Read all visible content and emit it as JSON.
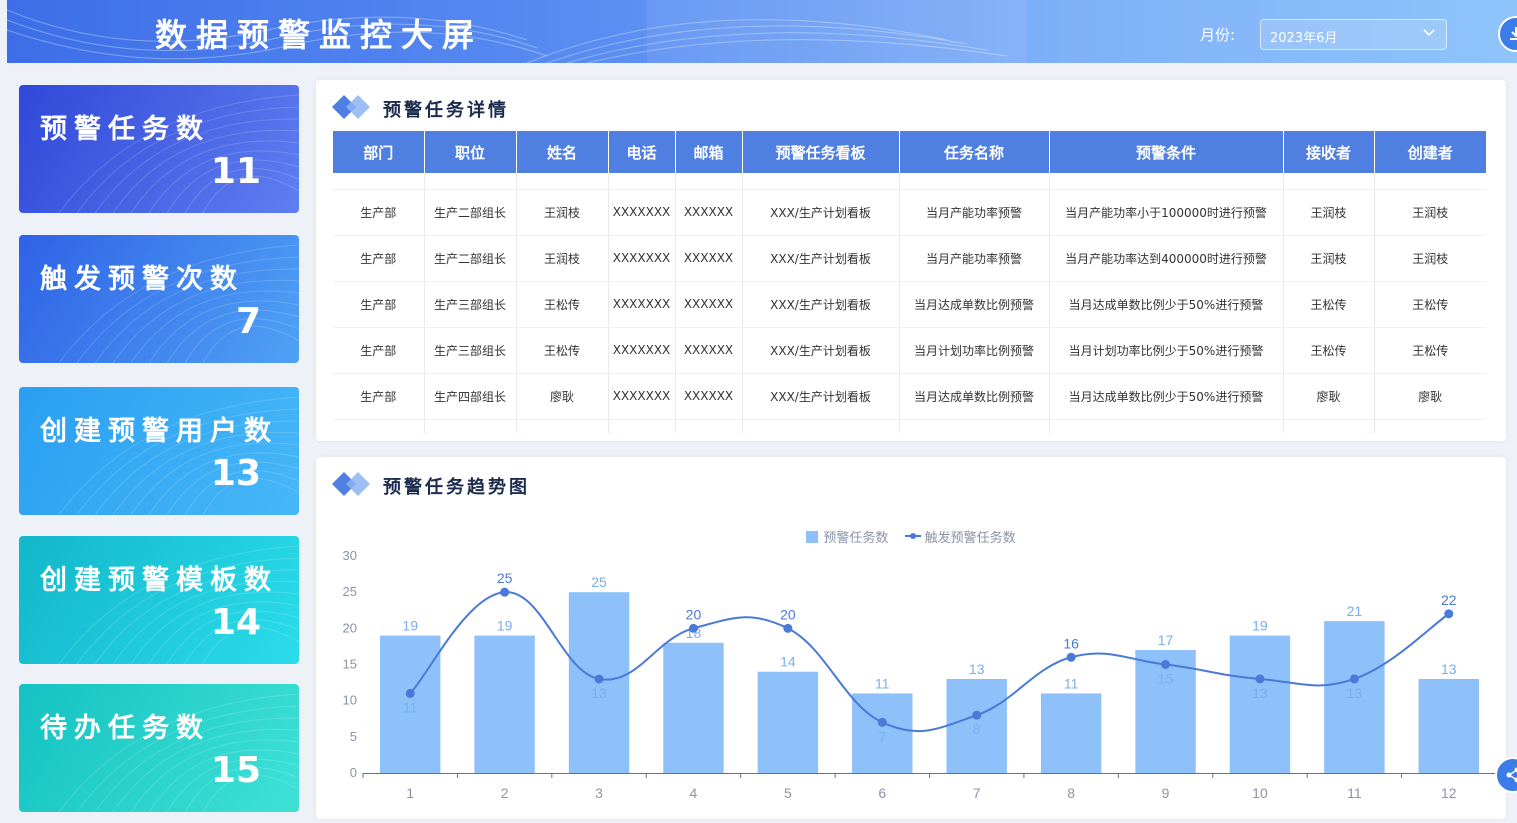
{
  "header": {
    "title": "数据预警监控大屏",
    "month_label": "月份:",
    "month_value": "2023年6月"
  },
  "kpis": [
    {
      "label": "预警任务数",
      "value": "11",
      "color_from": "#3048d9",
      "color_to": "#5f7ff0"
    },
    {
      "label": "触发预警次数",
      "value": "7",
      "color_from": "#2f62e6",
      "color_to": "#4fa2f5"
    },
    {
      "label": "创建预警用户数",
      "value": "13",
      "color_from": "#2a9ff2",
      "color_to": "#47b7f7"
    },
    {
      "label": "创建预警模板数",
      "value": "14",
      "color_from": "#12b7c9",
      "color_to": "#2bdcea"
    },
    {
      "label": "待办任务数",
      "value": "15",
      "color_from": "#14c2c2",
      "color_to": "#3fe2d5"
    }
  ],
  "table_panel": {
    "title": "预警任务详情",
    "columns": [
      "部门",
      "职位",
      "姓名",
      "电话",
      "邮箱",
      "预警任务看板",
      "任务名称",
      "预警条件",
      "接收者",
      "创建者"
    ],
    "rows": [
      [
        "生产部",
        "生产二部组长",
        "王润枝",
        "XXXXXXX",
        "XXXXXX",
        "XXX/生产计划看板",
        "当月产能功率预警",
        "当月产能功率小于100000时进行预警",
        "王润枝",
        "王润枝"
      ],
      [
        "生产部",
        "生产二部组长",
        "王润枝",
        "XXXXXXX",
        "XXXXXX",
        "XXX/生产计划看板",
        "当月产能功率预警",
        "当月产能功率达到400000时进行预警",
        "王润枝",
        "王润枝"
      ],
      [
        "生产部",
        "生产三部组长",
        "王松传",
        "XXXXXXX",
        "XXXXXX",
        "XXX/生产计划看板",
        "当月达成单数比例预警",
        "当月达成单数比例少于50%进行预警",
        "王松传",
        "王松传"
      ],
      [
        "生产部",
        "生产三部组长",
        "王松传",
        "XXXXXXX",
        "XXXXXX",
        "XXX/生产计划看板",
        "当月计划功率比例预警",
        "当月计划功率比例少于50%进行预警",
        "王松传",
        "王松传"
      ],
      [
        "生产部",
        "生产四部组长",
        "廖耿",
        "XXXXXXX",
        "XXXXXX",
        "XXX/生产计划看板",
        "当月达成单数比例预警",
        "当月达成单数比例少于50%进行预警",
        "廖耿",
        "廖耿"
      ]
    ]
  },
  "chart_panel": {
    "title": "预警任务趋势图"
  },
  "chart_data": {
    "type": "bar",
    "categories": [
      "1",
      "2",
      "3",
      "4",
      "5",
      "6",
      "7",
      "8",
      "9",
      "10",
      "11",
      "12"
    ],
    "series": [
      {
        "name": "预警任务数",
        "type": "bar",
        "color": "#8ec1f9",
        "values": [
          19,
          19,
          25,
          18,
          14,
          11,
          13,
          11,
          17,
          19,
          21,
          13
        ]
      },
      {
        "name": "触发预警任务数",
        "type": "line",
        "color": "#4a79d8",
        "values": [
          11,
          25,
          13,
          20,
          20,
          7,
          8,
          16,
          15,
          13,
          13,
          22
        ]
      }
    ],
    "yticks": [
      "0",
      "5",
      "10",
      "15",
      "20",
      "25",
      "30"
    ],
    "ylim": [
      0,
      30
    ],
    "grid": false,
    "legend": "top-center"
  },
  "colors": {
    "accent": "#4f7fe0",
    "header_to": "#8fc4fb"
  }
}
